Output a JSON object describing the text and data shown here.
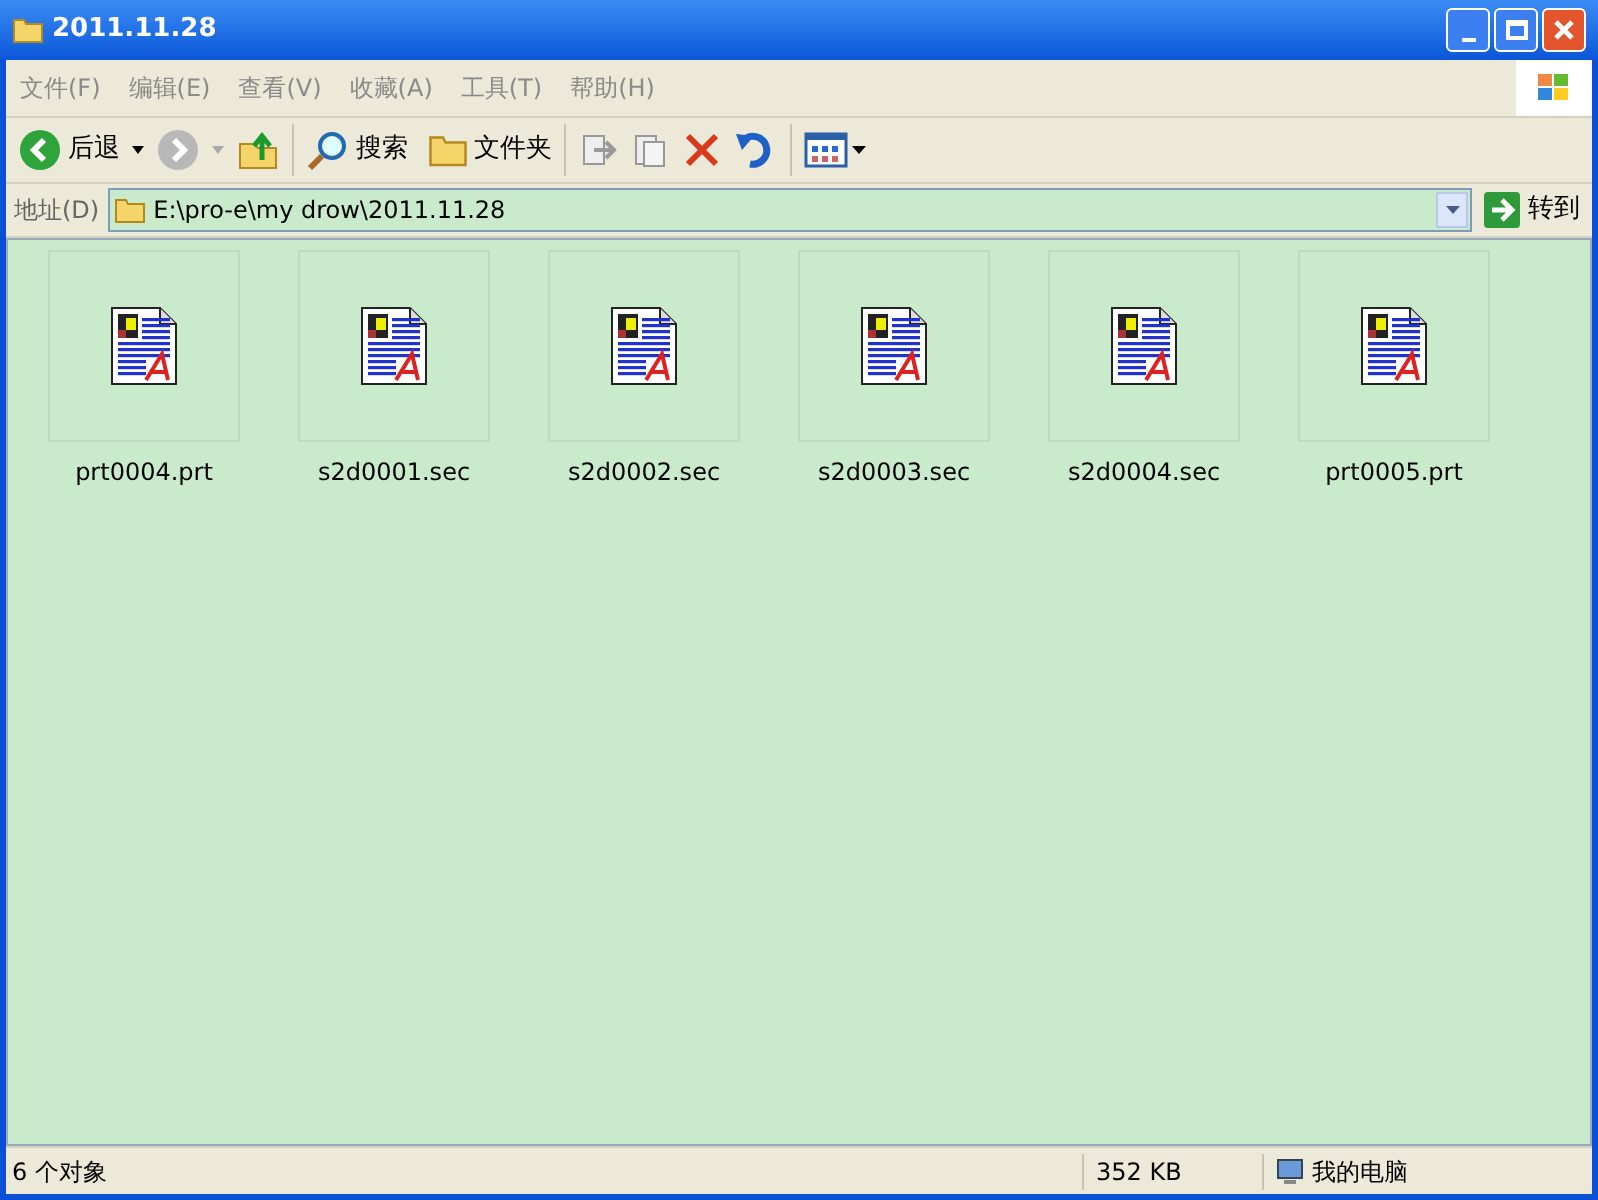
{
  "window": {
    "title": "2011.11.28"
  },
  "menu": [
    "文件(F)",
    "编辑(E)",
    "查看(V)",
    "收藏(A)",
    "工具(T)",
    "帮助(H)"
  ],
  "toolbar": {
    "back": "后退",
    "search": "搜索",
    "folders": "文件夹"
  },
  "address": {
    "label": "地址(D)",
    "value": "E:\\pro-e\\my drow\\2011.11.28",
    "go": "转到"
  },
  "files": [
    {
      "name": "prt0004.prt"
    },
    {
      "name": "s2d0001.sec"
    },
    {
      "name": "s2d0002.sec"
    },
    {
      "name": "s2d0003.sec"
    },
    {
      "name": "s2d0004.sec"
    },
    {
      "name": "prt0005.prt"
    }
  ],
  "status_bar": {
    "count": "6 个对象",
    "size": "352 KB",
    "location": "我的电脑"
  }
}
